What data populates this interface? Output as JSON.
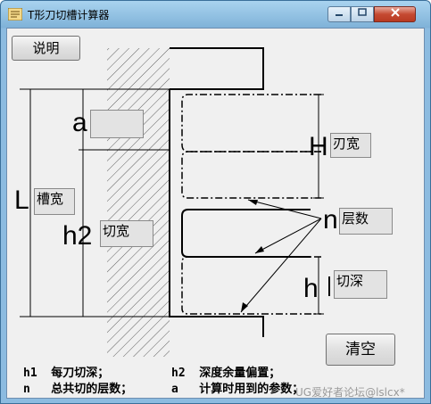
{
  "window": {
    "title": "T形刀切槽计算器"
  },
  "buttons": {
    "help": "说明",
    "clear": "清空"
  },
  "diagram_labels": {
    "a": "a",
    "H": "H",
    "L": "L",
    "h2": "h2",
    "n": "n",
    "h": "h"
  },
  "fields": {
    "a": {
      "value": ""
    },
    "blade_width": {
      "value": "刃宽"
    },
    "slot_width": {
      "value": "槽宽"
    },
    "cut_width": {
      "value": "切宽"
    },
    "layers": {
      "value": "层数"
    },
    "cut_depth": {
      "value": "切深"
    }
  },
  "notes": {
    "line1_left": "h1  每刀切深；",
    "line1_right": "h2  深度余量偏置；",
    "line2_left": "n   总共切的层数；",
    "line2_right": "a   计算时用到的参数；"
  },
  "watermark": "UG爱好者论坛@lslcx*",
  "colors": {
    "window_frame": "#8cbbe0",
    "close": "#c54a32"
  }
}
